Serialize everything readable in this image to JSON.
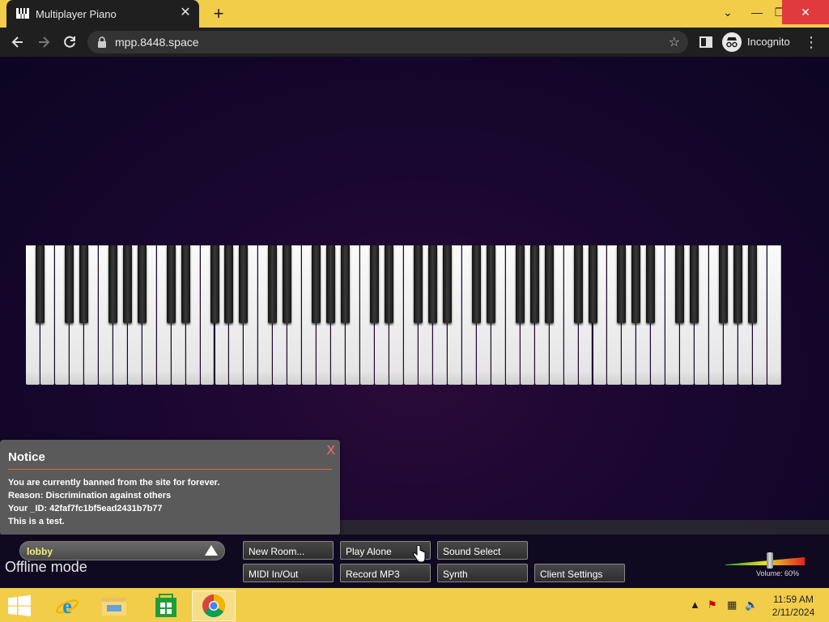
{
  "browser": {
    "tab_title": "Multiplayer Piano",
    "url": "mpp.8448.space",
    "profile_label": "Incognito",
    "new_tab_symbol": "+"
  },
  "notice": {
    "title": "Notice",
    "close_label": "X",
    "lines": [
      "You are currently banned from the site for forever.",
      "Reason: Discrimination against others",
      "Your _ID: 42faf7fc1bf5ead2431b7b77",
      "This is a test."
    ]
  },
  "room": {
    "name": "lobby",
    "status": "Offline mode"
  },
  "buttons": {
    "new_room": "New Room...",
    "play_alone": "Play Alone",
    "sound_select": "Sound Select",
    "midi": "MIDI In/Out",
    "record": "Record MP3",
    "synth": "Synth",
    "client_settings": "Client Settings"
  },
  "volume": {
    "label": "Volume: 60%",
    "level": 0.6
  },
  "taskbar": {
    "time": "11:59 AM",
    "date": "2/11/2024"
  },
  "icons": {
    "tab": "piano-icon",
    "back": "arrow-left-icon",
    "forward": "arrow-right-icon",
    "reload": "reload-icon",
    "lock": "lock-icon",
    "bookmark": "star-icon",
    "side_panel": "side-panel-icon",
    "menu": "kebab-menu-icon"
  },
  "colors": {
    "title_bar": "#f2cd4a",
    "notice_close": "#ff6b6b",
    "room_name": "#f0f078"
  }
}
